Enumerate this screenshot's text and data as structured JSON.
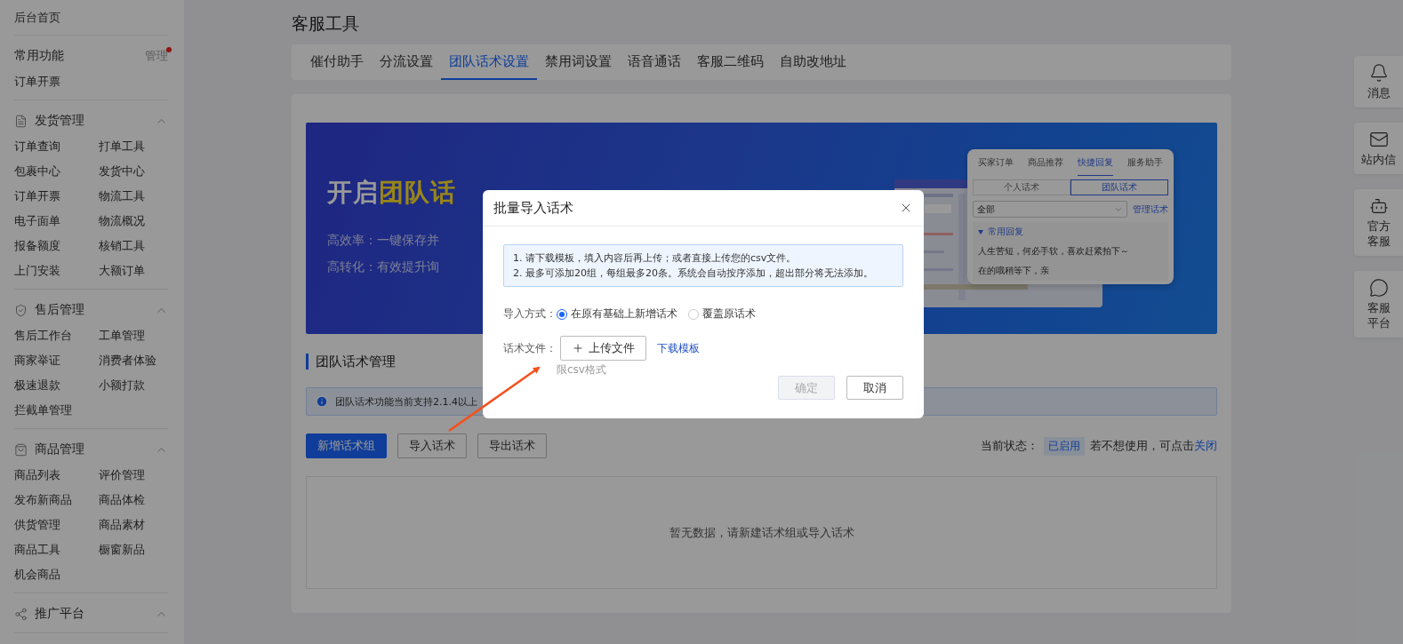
{
  "sidebar": {
    "home": "后台首页",
    "common": {
      "title": "常用功能",
      "manage": "管理",
      "has_notice": true,
      "items": [
        "订单开票"
      ]
    },
    "groups": [
      {
        "title": "发货管理",
        "expanded": true,
        "items": [
          "订单查询",
          "打单工具",
          "包裹中心",
          "发货中心",
          "订单开票",
          "物流工具",
          "电子面单",
          "物流概况",
          "报备额度",
          "核销工具",
          "上门安装",
          "大额订单"
        ]
      },
      {
        "title": "售后管理",
        "expanded": true,
        "items": [
          "售后工作台",
          "工单管理",
          "商家举证",
          "消费者体验",
          "极速退款",
          "小额打款",
          "拦截单管理"
        ]
      },
      {
        "title": "商品管理",
        "expanded": true,
        "items": [
          "商品列表",
          "评价管理",
          "发布新商品",
          "商品体检",
          "供货管理",
          "商品素材",
          "商品工具",
          "橱窗新品",
          "机会商品"
        ]
      },
      {
        "title": "推广平台",
        "expanded": true
      }
    ]
  },
  "page_title": "客服工具",
  "tabs": [
    {
      "label": "催付助手",
      "selected": false
    },
    {
      "label": "分流设置",
      "selected": false
    },
    {
      "label": "团队话术设置",
      "selected": true
    },
    {
      "label": "禁用词设置",
      "selected": false
    },
    {
      "label": "语音通话",
      "selected": false
    },
    {
      "label": "客服二维码",
      "selected": false
    },
    {
      "label": "自助改地址",
      "selected": false
    }
  ],
  "banner": {
    "title_prefix": "开启",
    "title_highlight": "团队话",
    "lines": [
      "高效率：一键保存并",
      "高转化：有效提升询"
    ],
    "preview": {
      "tabs": [
        {
          "label": "买家订单",
          "selected": false
        },
        {
          "label": "商品推荐",
          "selected": false
        },
        {
          "label": "快捷回复",
          "selected": true
        },
        {
          "label": "服务助手",
          "selected": false
        }
      ],
      "segments": [
        {
          "label": "个人话术",
          "selected": false
        },
        {
          "label": "团队话术",
          "selected": true
        }
      ],
      "select": "全部",
      "manage_link": "管理话术",
      "group": {
        "title": "常用回复",
        "expanded": true,
        "items": [
          "人生苦短，何必手软，喜欢赶紧拍下～",
          "在的哦稍等下，亲"
        ]
      }
    }
  },
  "section_title": "团队话术管理",
  "notice": "团队话术功能当前支持2.1.4以上",
  "actions": [
    {
      "label": "新增话术组",
      "kind": "primary"
    },
    {
      "label": "导入话术",
      "kind": "default"
    },
    {
      "label": "导出话术",
      "kind": "default"
    }
  ],
  "status": {
    "label": "当前状态：",
    "badge": "已启用",
    "hint": "若不想使用，可点击",
    "link": "关闭"
  },
  "empty_text": "暂无数据，请新建话术组或导入话术",
  "float_bar": [
    {
      "lines": [
        "消息"
      ]
    },
    {
      "lines": [
        "站内信"
      ]
    },
    {
      "lines": [
        "官方",
        "客服"
      ]
    },
    {
      "lines": [
        "客服",
        "平台"
      ]
    }
  ],
  "dialog": {
    "title": "批量导入话术",
    "tips": [
      "1. 请下载模板，填入内容后再上传；或者直接上传您的csv文件。",
      "2. 最多可添加20组，每组最多20条。系统会自动按序添加，超出部分将无法添加。"
    ],
    "mode": {
      "label": "导入方式：",
      "options": [
        {
          "label": "在原有基础上新增话术",
          "selected": true
        },
        {
          "label": "覆盖原话术",
          "selected": false
        }
      ]
    },
    "file": {
      "label": "话术文件：",
      "upload": "上传文件",
      "template_link": "下载模板",
      "hint": "限csv格式"
    },
    "buttons": [
      {
        "label": "确定",
        "kind": "primary",
        "disabled": true
      },
      {
        "label": "取消",
        "kind": "default",
        "disabled": false
      }
    ]
  }
}
